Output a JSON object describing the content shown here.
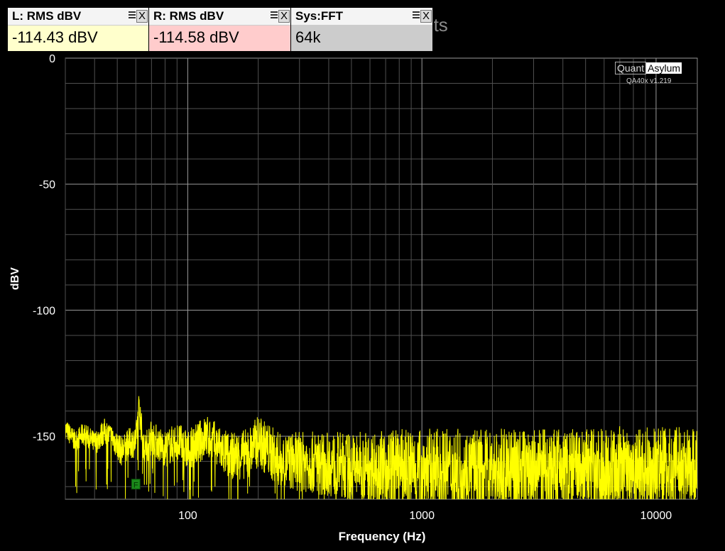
{
  "background_title": "ments",
  "widgets": [
    {
      "title": "L: RMS dBV",
      "value": "-114.43 dBV",
      "close": "X"
    },
    {
      "title": "R: RMS dBV",
      "value": "-114.58 dBV",
      "close": "X"
    },
    {
      "title": "Sys:FFT",
      "value": "64k",
      "close": "X"
    }
  ],
  "brand": {
    "quant": "Quant",
    "asylum": "Asylum",
    "version": "QA40x v1.219"
  },
  "marker_label": "F",
  "chart_data": {
    "type": "line",
    "xlabel": "Frequency (Hz)",
    "ylabel": "dBV",
    "x_scale": "log",
    "xlim": [
      30,
      15000
    ],
    "ylim": [
      -175,
      0
    ],
    "x_ticks": [
      100,
      1000,
      10000
    ],
    "x_tick_labels": [
      "100",
      "1000",
      "10000"
    ],
    "y_ticks": [
      0,
      -50,
      -100,
      -150
    ],
    "y_tick_labels": [
      "0",
      "-50",
      "-100",
      "-150"
    ],
    "grid": true,
    "series": [
      {
        "color": "#ffff00",
        "x": [
          30,
          33,
          36,
          40,
          44,
          48,
          52,
          56,
          60,
          62,
          65,
          70,
          75,
          80,
          90,
          100,
          120,
          150,
          180,
          200,
          250,
          300,
          400,
          500,
          700,
          1000,
          1500,
          2000,
          3000,
          5000,
          7000,
          10000,
          15000
        ],
        "y": [
          -147,
          -152,
          -149,
          -153,
          -148,
          -151,
          -156,
          -153,
          -152,
          -138,
          -156,
          -150,
          -153,
          -155,
          -152,
          -156,
          -150,
          -158,
          -157,
          -152,
          -160,
          -160,
          -161,
          -162,
          -162,
          -163,
          -163,
          -163,
          -163,
          -163,
          -162,
          -162,
          -162
        ]
      }
    ],
    "markers": [
      {
        "label": "F",
        "x": 60,
        "y": -169
      }
    ]
  }
}
